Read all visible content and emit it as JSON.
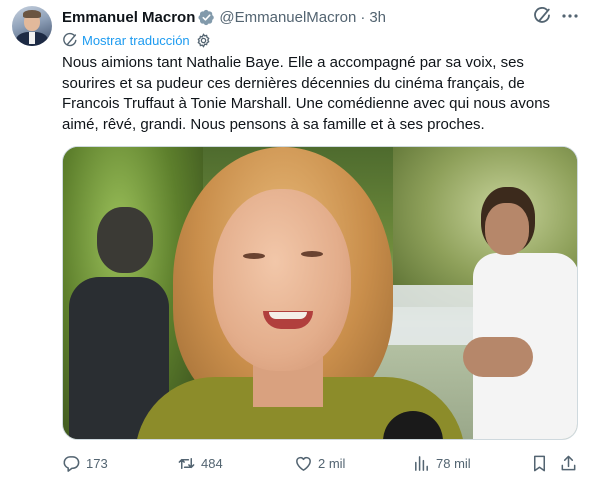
{
  "author": {
    "name": "Emmanuel Macron",
    "handle": "@EmmanuelMacron",
    "separator": "·",
    "time": "3h"
  },
  "translate": {
    "label": "Mostrar traducción"
  },
  "tweet": {
    "text": "Nous aimions tant Nathalie Baye. Elle a accompagné par sa voix, ses\nsourires et sa pudeur ces dernières décennies du cinéma français, de\nFrancois Truffaut à Tonie Marshall. Une comédienne avec qui nous avons\naimé, rêvé, grandi. Nous pensons à sa famille et à ses proches."
  },
  "actions": {
    "replies": "173",
    "retweets": "484",
    "likes": "2 mil",
    "views": "78 mil"
  },
  "icons": {
    "verified": "verified-badge-icon",
    "grok": "grok-icon",
    "more": "more-icon",
    "translate": "globe-icon",
    "settings": "gear-icon",
    "reply": "reply-icon",
    "retweet": "retweet-icon",
    "like": "heart-icon",
    "views": "views-icon",
    "bookmark": "bookmark-icon",
    "share": "share-icon"
  },
  "colors": {
    "text": "#0f1419",
    "secondary": "#536471",
    "link": "#1d9bf0",
    "verified": "#829aab"
  }
}
